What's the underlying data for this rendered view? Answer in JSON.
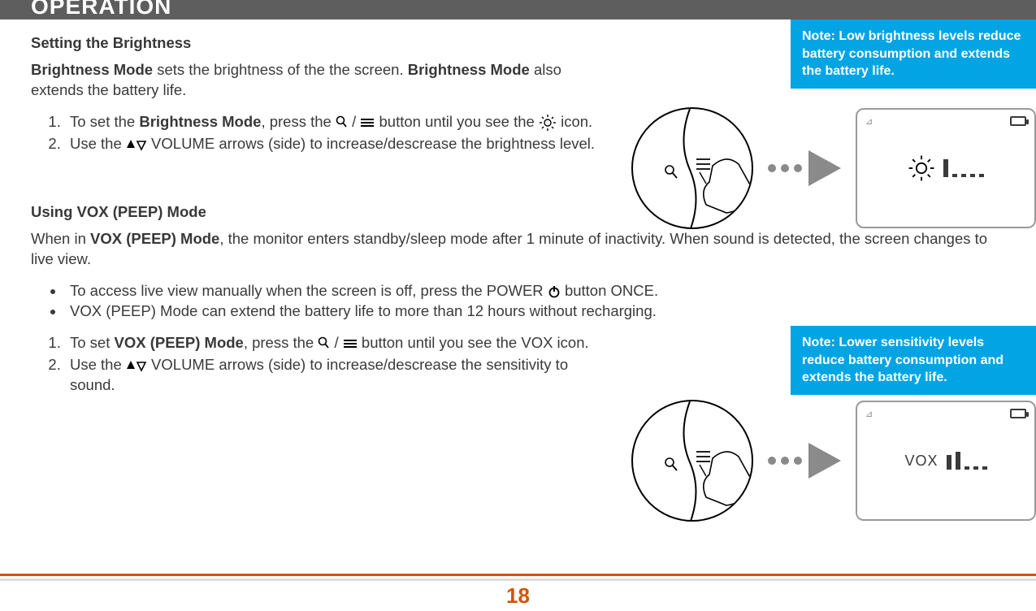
{
  "header": {
    "title": "OPERATION"
  },
  "page_number": "18",
  "notes": {
    "note1": "Note: Low brightness levels reduce battery consumption and extends the battery life.",
    "note2": "Note: Lower sensitivity levels reduce battery consumption and extends the battery life."
  },
  "section1": {
    "title": "Setting the Brightness",
    "intro_1": "Brightness Mode",
    "intro_2": " sets the brightness of the the screen. ",
    "intro_3": "Brightness Mode",
    "intro_4": " also extends the battery life.",
    "step1_a": "To set the ",
    "step1_b": "Brightness Mode",
    "step1_c": ", press the ",
    "step1_d": " button until you see the ",
    "step1_e": " icon.",
    "step2_a": "Use the ",
    "step2_b": " VOLUME arrows (side) to increase/descrease the brightness level."
  },
  "section2": {
    "title": "Using VOX (PEEP) Mode",
    "intro_a": "When in ",
    "intro_b": "VOX (PEEP) Mode",
    "intro_c": ", the monitor enters standby/sleep mode after 1 minute of inactivity. When sound is detected, the screen changes to live view.",
    "bullet1_a": "To access live view manually when the screen is off, press the POWER ",
    "bullet1_b": " button ONCE.",
    "bullet2": "VOX (PEEP) Mode can extend the battery life to more than 12 hours without recharging.",
    "step1_a": "To set ",
    "step1_b": "VOX (PEEP) Mode",
    "step1_c": ", press the ",
    "step1_d": " button until you see the VOX icon.",
    "step2_a": "Use the ",
    "step2_b": " VOLUME arrows (side) to increase/descrease the sensitivity to sound."
  },
  "screen2_label": "VOX",
  "icons": {
    "zoom": "zoom-icon",
    "menu": "menu-icon",
    "sun": "sun-icon",
    "volume_arrows": "volume-arrows-icon",
    "power": "power-icon"
  }
}
